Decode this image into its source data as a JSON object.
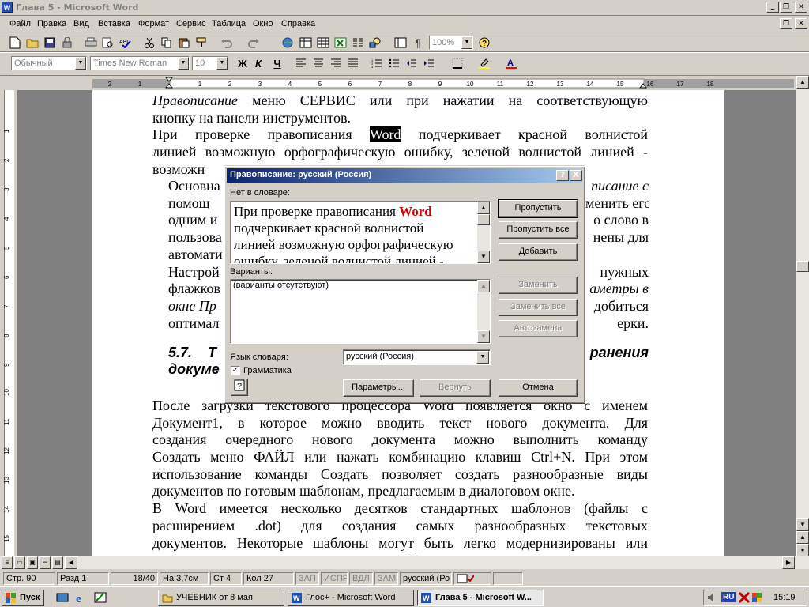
{
  "window": {
    "title": "Глава 5 - Microsoft Word",
    "app_badge": "W"
  },
  "menu": [
    "Файл",
    "Правка",
    "Вид",
    "Вставка",
    "Формат",
    "Сервис",
    "Таблица",
    "Окно",
    "Справка"
  ],
  "toolbar_std": {
    "zoom": "100%"
  },
  "toolbar_fmt": {
    "style": "Обычный",
    "font": "Times New Roman",
    "size": "10",
    "bold": "Ж",
    "italic": "К",
    "underline": "Ч"
  },
  "ruler": {
    "h_ticks": [
      "2",
      "1",
      "1",
      "2",
      "3",
      "4",
      "5",
      "6",
      "7",
      "8",
      "9",
      "10",
      "11",
      "12",
      "13",
      "14",
      "15",
      "16",
      "17",
      "18"
    ],
    "v_ticks": [
      "1",
      "2",
      "3",
      "4",
      "5",
      "6",
      "7",
      "8",
      "9",
      "10",
      "11",
      "12",
      "13",
      "14",
      "15",
      "16"
    ]
  },
  "document": {
    "lines_top": [
      {
        "a": "Правописание",
        "b": " меню СЕРВИС или при нажатии на соответствующую"
      },
      {
        "a": "",
        "b": "кнопку на панели инструментов."
      },
      {
        "a": "При проверке правописания ",
        "hl": "Word",
        "b": " подчеркивает красной волнистой"
      },
      {
        "a": "",
        "b": "линией возможную орфографическую ошибку, зеленой волнистой линией -"
      },
      {
        "a": "",
        "b": "возможн"
      },
      {
        "a": "Основна",
        "b": "писание с"
      },
      {
        "a": "помощ",
        "b": "менить его"
      },
      {
        "a": "одним и",
        "b": "о слово в"
      },
      {
        "a": "пользова",
        "b": "нены для"
      },
      {
        "a": "автомати",
        "b": ""
      },
      {
        "a": "Настрой",
        "b": "нужных"
      },
      {
        "a": "флажков",
        "b": "аметры в"
      },
      {
        "a": "окне Пр",
        "b": "добиться"
      },
      {
        "a": "оптимал",
        "b": "ерки."
      }
    ],
    "heading_left_1": "5.7.",
    "heading_left_2": "Т",
    "heading_right_1": "ранения",
    "heading_left_3": "докуме",
    "lines_bottom": [
      "После загрузки текстового процессора Word появляется окно с именем",
      "Документ1, в которое можно вводить текст нового документа. Для",
      "создания очередного нового документа можно выполнить команду",
      "Создать меню ФАЙЛ или нажать комбинацию клавиш Ctrl+N. При этом",
      "использование команды Создать позволяет создать разнообразные виды",
      "документов по готовым шаблонам, предлагаемым в диалоговом окне.",
      "В Word имеется несколько десятков стандартных шаблонов (файлы с",
      "расширением .dot) для создания самых разнообразных текстовых",
      "документов. Некоторые шаблоны могут быть легко модернизированы или"
    ],
    "line_partial": "М"
  },
  "dialog": {
    "title": "Правописание: русский (Россия)",
    "help_btn": "?",
    "close_btn": "X",
    "not_in_dict_label": "Нет в словаре:",
    "text_before": "При проверке правописания ",
    "text_word": "Word",
    "text_after_lines": [
      "подчеркивает красной волнистой",
      "линией возможную орфографическую",
      "ошибку, зеленой волнистой линией -"
    ],
    "suggestions_label": "Варианты:",
    "suggestions_value": "(варианты отсутствуют)",
    "dict_lang_label": "Язык словаря:",
    "dict_lang_value": "русский (Россия)",
    "grammar_label": "Грамматика",
    "grammar_checked": true,
    "buttons": {
      "skip": "Пропустить",
      "skip_all": "Пропустить все",
      "add": "Добавить",
      "replace": "Заменить",
      "replace_all": "Заменить все",
      "autocorrect": "Автозамена",
      "options": "Параметры...",
      "undo": "Вернуть",
      "cancel": "Отмена"
    }
  },
  "status": {
    "page": "Стр. 90",
    "section": "Разд 1",
    "pages": "18/40",
    "at": "На 3,7см",
    "ln": "Ст 4",
    "col": "Кол 27",
    "rec": "ЗАП",
    "trk": "ИСПР",
    "ext": "ВДЛ",
    "ovr": "ЗАМ",
    "lang": "русский (Ро"
  },
  "taskbar": {
    "start": "Пуск",
    "tasks": [
      "УЧЕБНИК от 8 мая",
      "Глос+ - Microsoft Word",
      "Глава 5 - Microsoft W..."
    ],
    "lang": "RU",
    "clock": "15:19"
  }
}
